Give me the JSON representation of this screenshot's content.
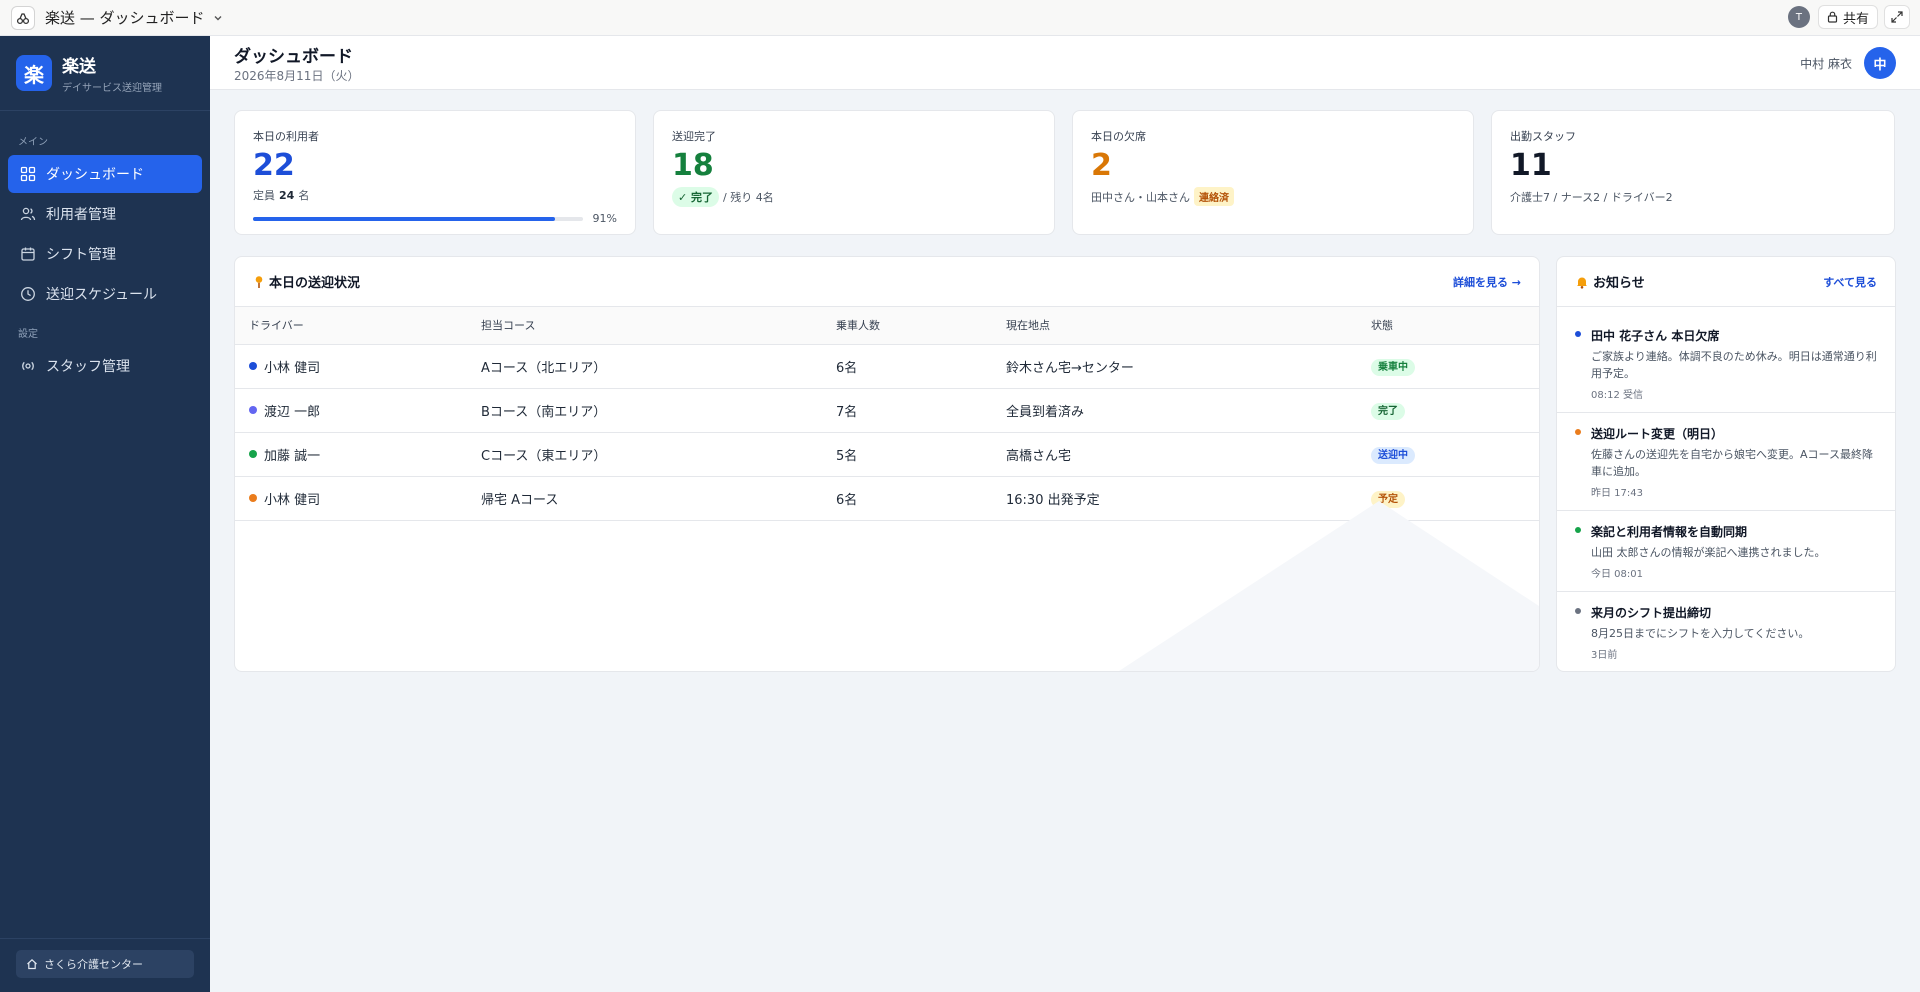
{
  "window": {
    "title": "楽送 — ダッシュボード",
    "user_initial": "T",
    "share_label": "共有"
  },
  "sidebar": {
    "brand_name": "楽送",
    "brand_sub": "デイサービス送迎管理",
    "logo_char": "楽",
    "section_main": "メイン",
    "section_settings": "設定",
    "items": [
      {
        "label": "ダッシュボード",
        "icon": "grid-icon"
      },
      {
        "label": "利用者管理",
        "icon": "users-icon"
      },
      {
        "label": "シフト管理",
        "icon": "calendar-icon"
      },
      {
        "label": "送迎スケジュール",
        "icon": "clock-icon"
      }
    ],
    "settings_items": [
      {
        "label": "スタッフ管理",
        "icon": "broadcast-icon"
      }
    ],
    "facility": "さくら介護センター"
  },
  "header": {
    "title": "ダッシュボード",
    "date": "2026年8月11日（火）",
    "user_name": "中村 麻衣",
    "avatar": "中"
  },
  "stats": {
    "users": {
      "label": "本日の利用者",
      "value": "22",
      "capacity_prefix": "定員",
      "capacity": "24",
      "capacity_suffix": "名",
      "percent_label": "91%",
      "fraction": 0.917
    },
    "completed": {
      "label": "送迎完了",
      "value": "18",
      "pill": "完了",
      "rest": "/ 残り 4名"
    },
    "absent": {
      "label": "本日の欠席",
      "value": "2",
      "names": "田中さん・山本さん",
      "pill": "連絡済"
    },
    "staff": {
      "label": "出勤スタッフ",
      "value": "11",
      "breakdown": "介護士7 / ナース2 / ドライバー2"
    }
  },
  "status": {
    "title": "本日の送迎状況",
    "link": "詳細を見る →",
    "columns": [
      "ドライバー",
      "担当コース",
      "乗車人数",
      "現在地点",
      "状態"
    ],
    "rows": [
      {
        "driver": "小林 健司",
        "course": "Aコース（北エリア）",
        "count": "6名",
        "location": "鈴木さん宅→センター",
        "state": "乗車中",
        "dot": "#1d4ed8",
        "badge": "badge-ride"
      },
      {
        "driver": "渡辺 一郎",
        "course": "Bコース（南エリア）",
        "count": "7名",
        "location": "全員到着済み",
        "state": "完了",
        "dot": "#6366f1",
        "badge": "badge-done"
      },
      {
        "driver": "加藤 誠一",
        "course": "Cコース（東エリア）",
        "count": "5名",
        "location": "高橋さん宅",
        "state": "送迎中",
        "dot": "#16a34a",
        "badge": "badge-transit"
      },
      {
        "driver": "小林 健司",
        "course": "帰宅 Aコース",
        "count": "6名",
        "location": "16:30 出発予定",
        "state": "予定",
        "dot": "#ea7c1c",
        "badge": "badge-plan"
      }
    ]
  },
  "notices": {
    "title": "お知らせ",
    "link": "すべて見る",
    "items": [
      {
        "title": "田中 花子さん 本日欠席",
        "body": "ご家族より連絡。体調不良のため休み。明日は通常通り利用予定。",
        "time": "08:12 受信",
        "color": "#1d4ed8"
      },
      {
        "title": "送迎ルート変更（明日）",
        "body": "佐藤さんの送迎先を自宅から娘宅へ変更。Aコース最終降車に追加。",
        "time": "昨日 17:43",
        "color": "#ea7c1c"
      },
      {
        "title": "楽記と利用者情報を自動同期",
        "body": "山田 太郎さんの情報が楽記へ連携されました。",
        "time": "今日 08:01",
        "color": "#16a34a"
      },
      {
        "title": "来月のシフト提出締切",
        "body": "8月25日までにシフトを入力してください。",
        "time": "3日前",
        "color": "#6b7280"
      }
    ]
  },
  "colors": {
    "accent": "#2563eb",
    "sidebar_bg": "#1e3351",
    "green": "#15803d",
    "orange": "#d97706"
  }
}
